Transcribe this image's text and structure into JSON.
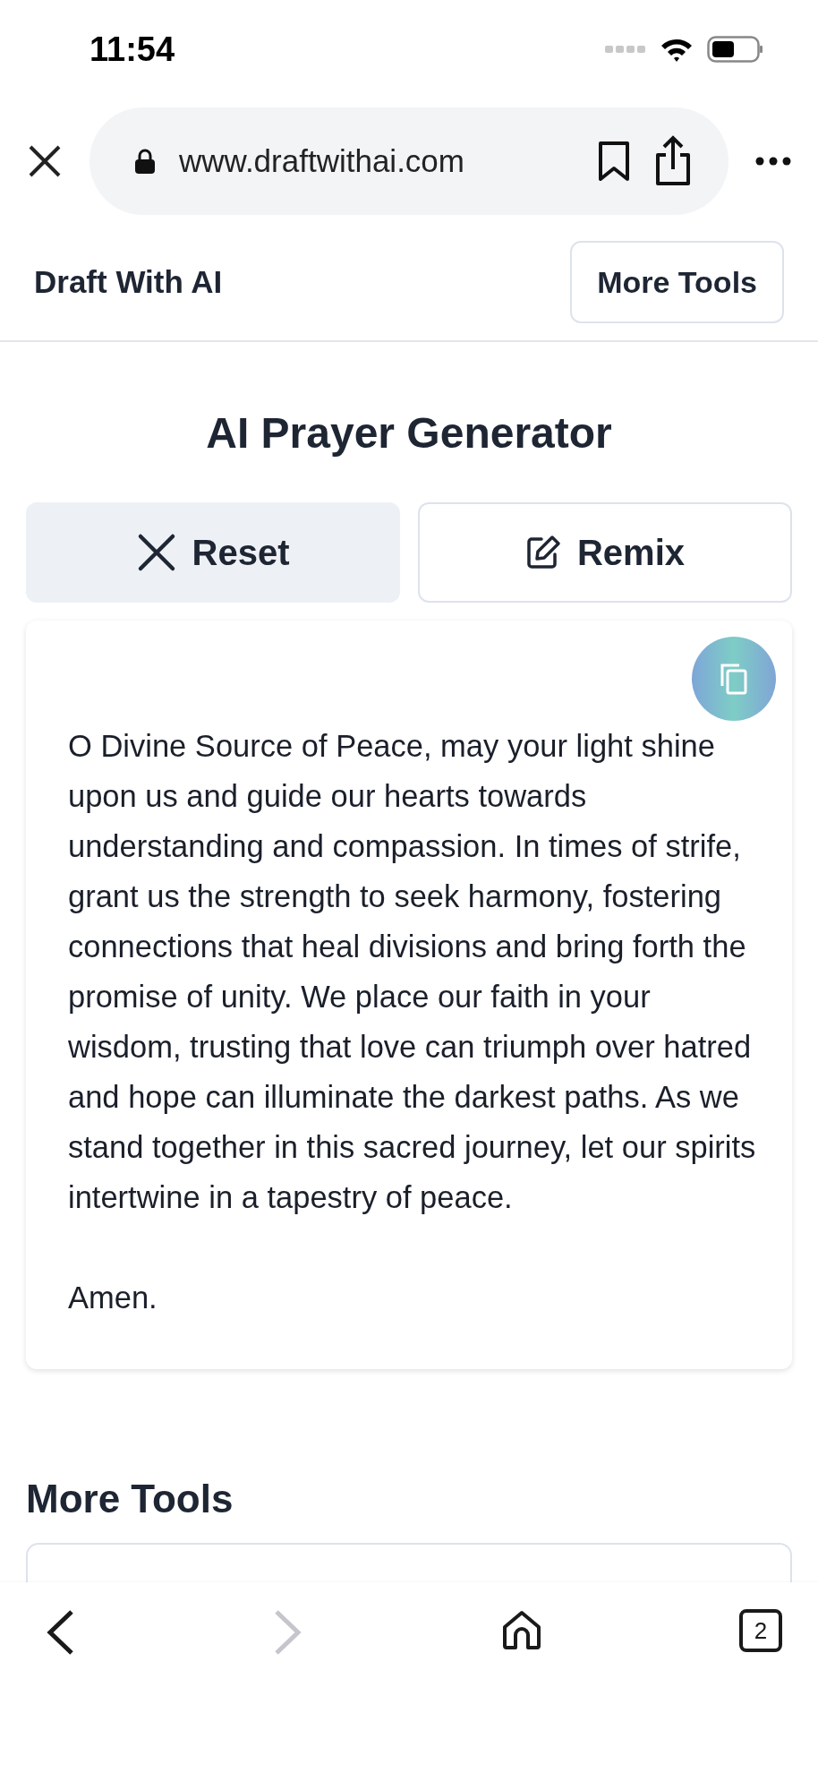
{
  "status_bar": {
    "time": "11:54"
  },
  "browser": {
    "url": "www.draftwithai.com",
    "tab_count": "2",
    "forward_disabled": true
  },
  "site_header": {
    "brand": "Draft With AI",
    "button": "More Tools"
  },
  "title": "AI Prayer Generator",
  "actions": [
    {
      "kind": "reset",
      "label": "Reset"
    },
    {
      "kind": "remix",
      "label": "Remix"
    }
  ],
  "prayer": {
    "paragraphs": [
      "O Divine Source of Peace, may your light shine upon us and guide our hearts towards understanding and compassion. In times of strife, grant us the strength to seek harmony, fostering connections that heal divisions and bring forth the promise of unity. We place our faith in your wisdom, trusting that love can triumph over hatred and hope can illuminate the darkest paths. As we stand together in this sacred journey, let our spirits intertwine in a tapestry of peace.",
      "Amen."
    ]
  },
  "more_tools": {
    "heading": "More Tools"
  }
}
